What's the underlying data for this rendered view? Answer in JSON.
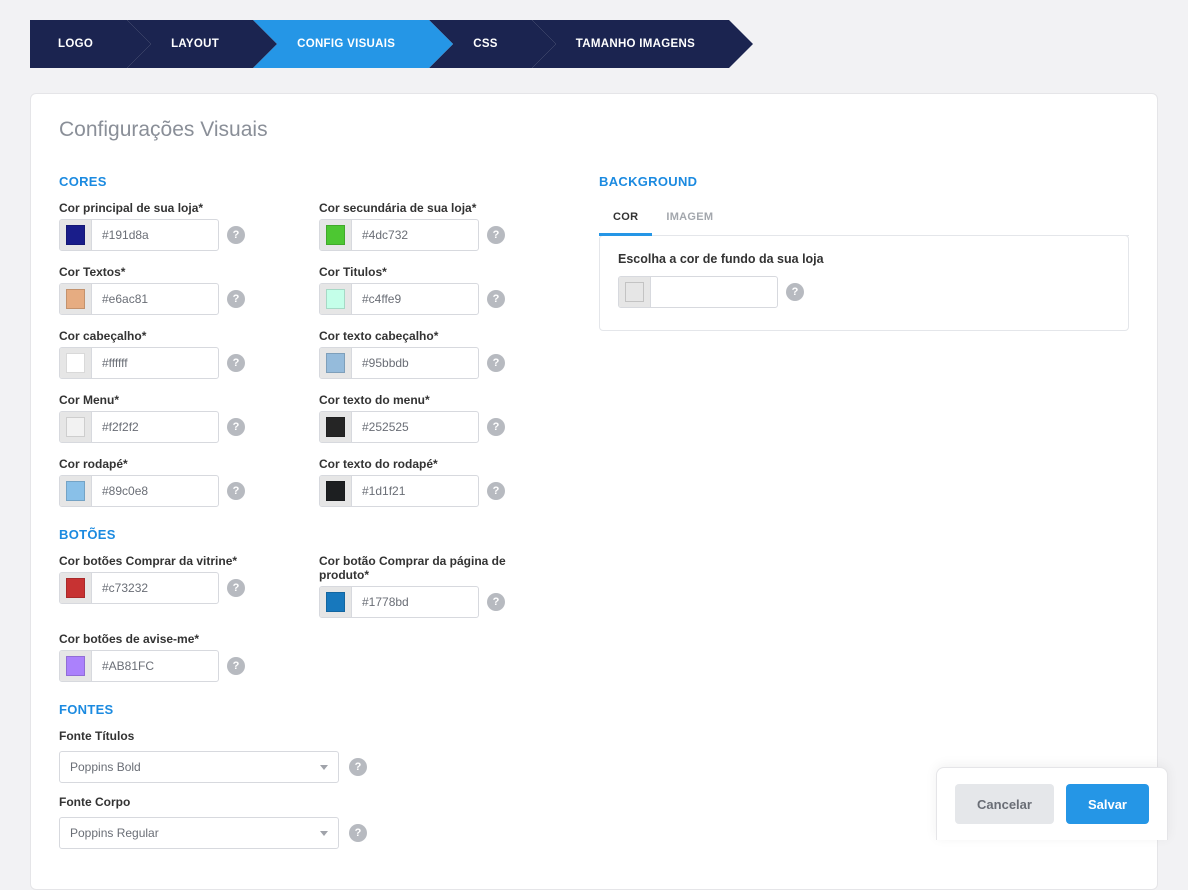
{
  "steps": [
    {
      "label": "LOGO",
      "active": false
    },
    {
      "label": "LAYOUT",
      "active": false
    },
    {
      "label": "CONFIG VISUAIS",
      "active": true
    },
    {
      "label": "CSS",
      "active": false
    },
    {
      "label": "TAMANHO IMAGENS",
      "active": false
    }
  ],
  "page_title": "Configurações Visuais",
  "sections": {
    "cores": "CORES",
    "botoes": "BOTÕES",
    "fontes": "FONTES",
    "background": "BACKGROUND"
  },
  "cores": {
    "principal": {
      "label": "Cor principal de sua loja*",
      "value": "#191d8a"
    },
    "secundaria": {
      "label": "Cor secundária de sua loja*",
      "value": "#4dc732"
    },
    "textos": {
      "label": "Cor Textos*",
      "value": "#e6ac81"
    },
    "titulos": {
      "label": "Cor Titulos*",
      "value": "#c4ffe9"
    },
    "cabecalho": {
      "label": "Cor cabeçalho*",
      "value": "#ffffff"
    },
    "texto_cabecalho": {
      "label": "Cor texto cabeçalho*",
      "value": "#95bbdb"
    },
    "menu": {
      "label": "Cor Menu*",
      "value": "#f2f2f2"
    },
    "texto_menu": {
      "label": "Cor texto do menu*",
      "value": "#252525"
    },
    "rodape": {
      "label": "Cor rodapé*",
      "value": "#89c0e8"
    },
    "texto_rodape": {
      "label": "Cor texto do rodapé*",
      "value": "#1d1f21"
    }
  },
  "botoes": {
    "comprar_vitrine": {
      "label": "Cor botões Comprar da vitrine*",
      "value": "#c73232"
    },
    "comprar_produto": {
      "label": "Cor botão Comprar da página de produto*",
      "value": "#1778bd"
    },
    "aviseme": {
      "label": "Cor botões de avise-me*",
      "value": "#AB81FC"
    }
  },
  "fontes": {
    "titulos": {
      "label": "Fonte Títulos",
      "value": "Poppins Bold"
    },
    "corpo": {
      "label": "Fonte Corpo",
      "value": "Poppins Regular"
    }
  },
  "background": {
    "tabs": {
      "cor": "COR",
      "imagem": "IMAGEM"
    },
    "instruction": "Escolha a cor de fundo da sua loja",
    "value": ""
  },
  "buttons": {
    "cancel": "Cancelar",
    "save": "Salvar"
  },
  "help_glyph": "?"
}
